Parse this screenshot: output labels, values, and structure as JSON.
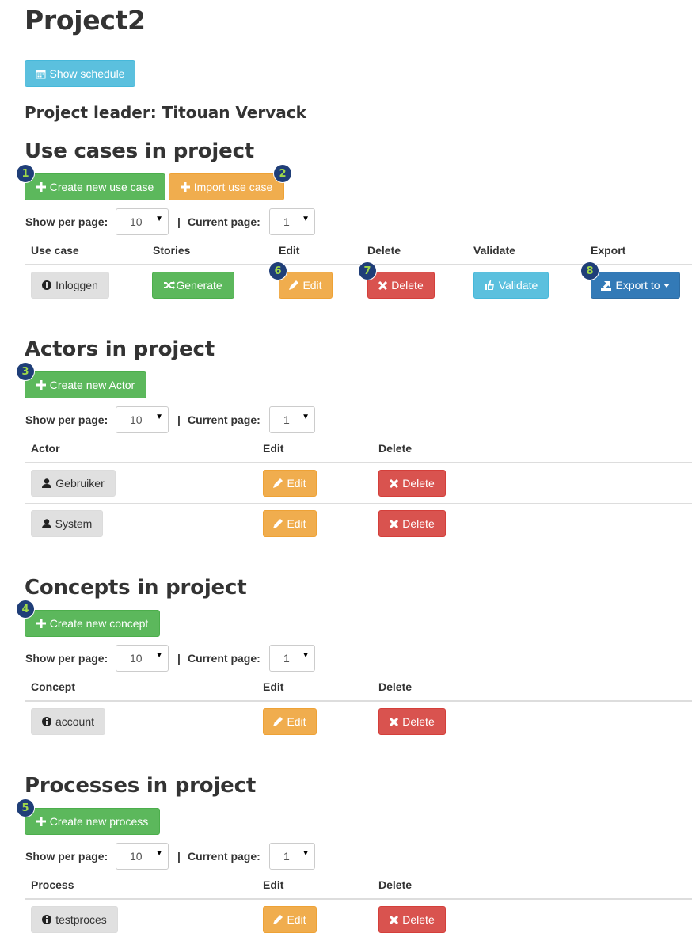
{
  "project": {
    "title": "Project2",
    "schedule_button": "Show schedule",
    "leader": "Project leader: Titouan Vervack"
  },
  "pagination": {
    "show_per_page_label": "Show per page:",
    "separator": "|",
    "current_page_label": "Current page:",
    "per_page": "10",
    "current_page": "1"
  },
  "use_cases": {
    "heading": "Use cases in project",
    "create_button": "Create new use case",
    "import_button": "Import use case",
    "columns": [
      "Use case",
      "Stories",
      "Edit",
      "Delete",
      "Validate",
      "Export"
    ],
    "rows": [
      {
        "name": "Inloggen",
        "stories_button": "Generate",
        "edit_button": "Edit",
        "delete_button": "Delete",
        "validate_button": "Validate",
        "export_button": "Export to"
      }
    ]
  },
  "actors": {
    "heading": "Actors in project",
    "create_button": "Create new Actor",
    "columns": [
      "Actor",
      "Edit",
      "Delete"
    ],
    "rows": [
      {
        "name": "Gebruiker",
        "edit_button": "Edit",
        "delete_button": "Delete"
      },
      {
        "name": "System",
        "edit_button": "Edit",
        "delete_button": "Delete"
      }
    ]
  },
  "concepts": {
    "heading": "Concepts in project",
    "create_button": "Create new concept",
    "columns": [
      "Concept",
      "Edit",
      "Delete"
    ],
    "rows": [
      {
        "name": "account",
        "edit_button": "Edit",
        "delete_button": "Delete"
      }
    ]
  },
  "processes": {
    "heading": "Processes in project",
    "create_button": "Create new process",
    "columns": [
      "Process",
      "Edit",
      "Delete"
    ],
    "rows": [
      {
        "name": "testproces",
        "edit_button": "Edit",
        "delete_button": "Delete"
      }
    ]
  },
  "annotations": [
    "1",
    "2",
    "3",
    "4",
    "5",
    "6",
    "7",
    "8"
  ],
  "colors": {
    "success": "#5cb85c",
    "warning": "#f0ad4e",
    "danger": "#d9534f",
    "info": "#5bc0de",
    "primary": "#337ab7",
    "badge": "#1f3e78",
    "badge_text": "#9fd84a"
  },
  "icons": {
    "schedule": "calendar-icon",
    "create": "plus-icon",
    "info": "info-circle-icon",
    "user": "user-icon",
    "generate": "shuffle-icon",
    "edit": "pencil-icon",
    "delete": "remove-icon",
    "validate": "thumbs-up-icon",
    "export": "export-icon",
    "dropdown": "caret-down-icon"
  }
}
